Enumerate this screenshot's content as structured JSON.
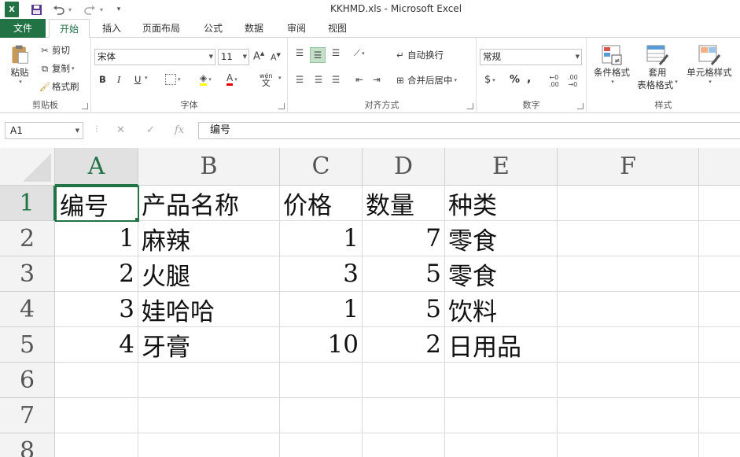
{
  "titlebar": {
    "logo": "X",
    "doc_title": "KKHMD.xls - Microsoft Excel"
  },
  "tabs": [
    "文件",
    "开始",
    "插入",
    "页面布局",
    "公式",
    "数据",
    "审阅",
    "视图"
  ],
  "ribbon": {
    "clipboard": {
      "label": "剪贴板",
      "paste": "粘贴",
      "cut": "剪切",
      "copy": "复制",
      "format_painter": "格式刷"
    },
    "font": {
      "label": "字体",
      "name": "宋体",
      "size": "11",
      "bold": "B",
      "italic": "I",
      "underline": "U",
      "wen": "wén"
    },
    "alignment": {
      "label": "对齐方式",
      "wrap": "自动换行",
      "merge": "合并后居中"
    },
    "number": {
      "label": "数字",
      "format": "常规",
      "currency": "$",
      "percent": "%",
      "comma": ","
    },
    "styles": {
      "label": "样式",
      "conditional": "条件格式",
      "table": "套用",
      "table2": "表格格式",
      "cell": "单元格样式"
    }
  },
  "formula_bar": {
    "name_box": "A1",
    "cancel": "✕",
    "enter": "✓",
    "fx": "fx",
    "content": "编号"
  },
  "sheet": {
    "columns": [
      "A",
      "B",
      "C",
      "D",
      "E",
      "F"
    ],
    "rows": [
      "1",
      "2",
      "3",
      "4",
      "5",
      "6",
      "7",
      "8"
    ],
    "cells": [
      [
        "编号",
        "产品名称",
        "价格",
        "数量",
        "种类"
      ],
      [
        "1",
        "麻辣",
        "1",
        "7",
        "零食"
      ],
      [
        "2",
        "火腿",
        "3",
        "5",
        "零食"
      ],
      [
        "3",
        "娃哈哈",
        "1",
        "5",
        "饮料"
      ],
      [
        "4",
        "牙膏",
        "10",
        "2",
        "日用品"
      ]
    ]
  },
  "colors": {
    "excel_green": "#217346",
    "gridline": "#dadada",
    "header_bg": "#f3f3f3"
  }
}
